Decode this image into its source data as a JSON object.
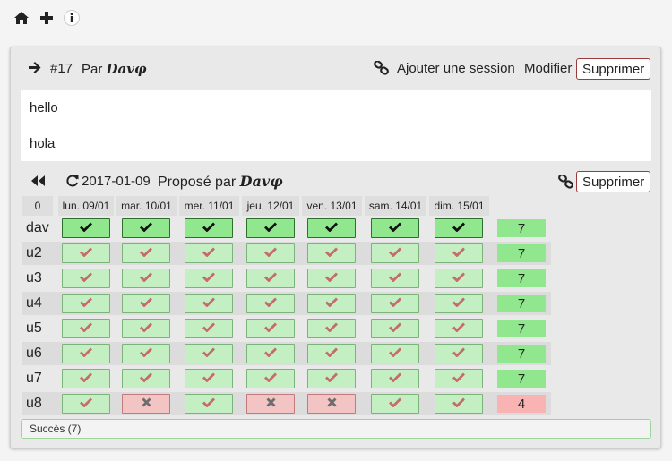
{
  "topnav": {
    "icons": [
      "home-icon",
      "plus-icon",
      "info-icon"
    ]
  },
  "poll": {
    "id": "#17",
    "by_prefix": "Par",
    "author": "𝓓𝓪𝓿𝓿𝓹",
    "author_plain": "Davφ",
    "add_session": "Ajouter une session",
    "modify": "Modifier",
    "delete": "Supprimer"
  },
  "messages": [
    "hello",
    "hola"
  ],
  "session": {
    "date": "2017-01-09",
    "proposed_prefix": "Proposé par",
    "author_plain": "Davφ",
    "delete": "Supprimer",
    "corner": "0",
    "days": [
      "lun. 09/01",
      "mar. 10/01",
      "mer. 11/01",
      "jeu. 12/01",
      "ven. 13/01",
      "sam. 14/01",
      "dim. 15/01"
    ],
    "rows": [
      {
        "user": "dav",
        "own": true,
        "votes": [
          "yes",
          "yes",
          "yes",
          "yes",
          "yes",
          "yes",
          "yes"
        ],
        "total": "7",
        "status": "ok"
      },
      {
        "user": "u2",
        "own": false,
        "votes": [
          "yes",
          "yes",
          "yes",
          "yes",
          "yes",
          "yes",
          "yes"
        ],
        "total": "7",
        "status": "ok"
      },
      {
        "user": "u3",
        "own": false,
        "votes": [
          "yes",
          "yes",
          "yes",
          "yes",
          "yes",
          "yes",
          "yes"
        ],
        "total": "7",
        "status": "ok"
      },
      {
        "user": "u4",
        "own": false,
        "votes": [
          "yes",
          "yes",
          "yes",
          "yes",
          "yes",
          "yes",
          "yes"
        ],
        "total": "7",
        "status": "ok"
      },
      {
        "user": "u5",
        "own": false,
        "votes": [
          "yes",
          "yes",
          "yes",
          "yes",
          "yes",
          "yes",
          "yes"
        ],
        "total": "7",
        "status": "ok"
      },
      {
        "user": "u6",
        "own": false,
        "votes": [
          "yes",
          "yes",
          "yes",
          "yes",
          "yes",
          "yes",
          "yes"
        ],
        "total": "7",
        "status": "ok"
      },
      {
        "user": "u7",
        "own": false,
        "votes": [
          "yes",
          "yes",
          "yes",
          "yes",
          "yes",
          "yes",
          "yes"
        ],
        "total": "7",
        "status": "ok"
      },
      {
        "user": "u8",
        "own": false,
        "votes": [
          "yes",
          "no",
          "yes",
          "no",
          "no",
          "yes",
          "yes"
        ],
        "total": "4",
        "status": "bad"
      }
    ],
    "footer": "Succès (7)"
  },
  "colors": {
    "own_cell": "#91e78e",
    "yes_cell": "#c4efc2",
    "no_cell": "#f2c4c4",
    "ok_total": "#91e78e",
    "bad_total": "#f9b3b3",
    "delete_border": "#9a3b3b"
  }
}
